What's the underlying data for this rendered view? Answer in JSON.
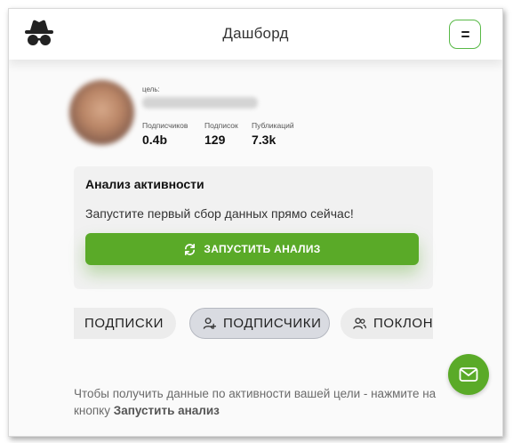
{
  "header": {
    "title": "Дашборд",
    "logo_icon": "incognito-spy-icon",
    "menu_icon": "menu-icon"
  },
  "profile": {
    "target_label": "цель:",
    "stats": [
      {
        "label": "Подписчиков",
        "value": "0.4b"
      },
      {
        "label": "Подписок",
        "value": "129"
      },
      {
        "label": "Публикаций",
        "value": "7.3k"
      }
    ]
  },
  "activity": {
    "title": "Анализ активности",
    "text": "Запустите первый сбор данных прямо сейчас!",
    "button_label": "ЗАПУСТИТЬ АНАЛИЗ",
    "button_icon": "refresh-icon"
  },
  "tabs": [
    {
      "label": "ПОДПИСКИ",
      "icon": "user-minus-icon",
      "active": false
    },
    {
      "label": "ПОДПИСЧИКИ",
      "icon": "user-plus-icon",
      "active": true
    },
    {
      "label": "ПОКЛОННИКИ",
      "icon": "users-icon",
      "active": false
    }
  ],
  "hint": {
    "text": "Чтобы получить данные по активности вашей цели - нажмите на кнопку ",
    "action": "Запустить анализ"
  },
  "colors": {
    "accent": "#5aaa28",
    "accent_border": "#58b947",
    "card_bg": "#f1f1f1",
    "tab_bg": "#ececec"
  },
  "fab_icon": "mail-icon"
}
